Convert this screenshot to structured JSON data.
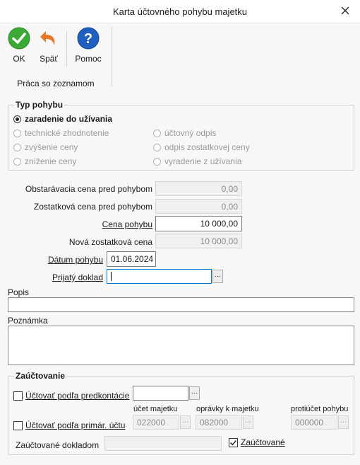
{
  "window": {
    "title": "Karta účtovného pohybu majetku"
  },
  "toolbar": {
    "ok_label": "OK",
    "back_label": "Späť",
    "help_label": "Pomoc",
    "group_label": "Práca so zoznamom"
  },
  "movement_type": {
    "legend": "Typ pohybu",
    "options": [
      {
        "label": "zaradenie do užívania",
        "selected": true
      },
      {
        "label": "technické zhodnotenie",
        "selected": false
      },
      {
        "label": "zvýšenie ceny",
        "selected": false
      },
      {
        "label": "zníženie ceny",
        "selected": false
      },
      {
        "label": "účtovný odpis",
        "selected": false
      },
      {
        "label": "odpis zostatkovej ceny",
        "selected": false
      },
      {
        "label": "vyradenie z užívania",
        "selected": false
      }
    ]
  },
  "fields": {
    "acq_price_before_label": "Obstarávacia cena pred pohybom",
    "acq_price_before_value": "0,00",
    "residual_before_label": "Zostatková cena pred pohybom",
    "residual_before_value": "0,00",
    "price_label": "Cena pohybu",
    "price_value": "10 000,00",
    "new_residual_label": "Nová zostatková cena",
    "new_residual_value": "10 000,00",
    "date_label": "Dátum pohybu",
    "date_value": "01.06.2024",
    "document_label": "Prijatý doklad",
    "document_value": "",
    "description_label": "Popis",
    "description_value": "",
    "note_label": "Poznámka",
    "note_value": ""
  },
  "posting": {
    "legend": "Zaúčtovanie",
    "by_template_label": "Účtovať podľa predkontácie",
    "by_template_value": "",
    "by_primary_label": "Účtovať podľa primár. účtu",
    "asset_account_label": "účet majetku",
    "asset_account_value": "022000",
    "corrections_label": "oprávky k majetku",
    "corrections_value": "082000",
    "counter_account_label": "protiúčet pohybu",
    "counter_account_value": "000000",
    "posted_doc_label": "Zaúčtované dokladom",
    "posted_doc_value": "",
    "posted_label": "Zaúčtované",
    "posted_checked": true
  },
  "colors": {
    "accent": "#0078d7",
    "ok_green": "#3aa935",
    "back_orange": "#e8762b",
    "help_blue": "#1f5fbf"
  }
}
